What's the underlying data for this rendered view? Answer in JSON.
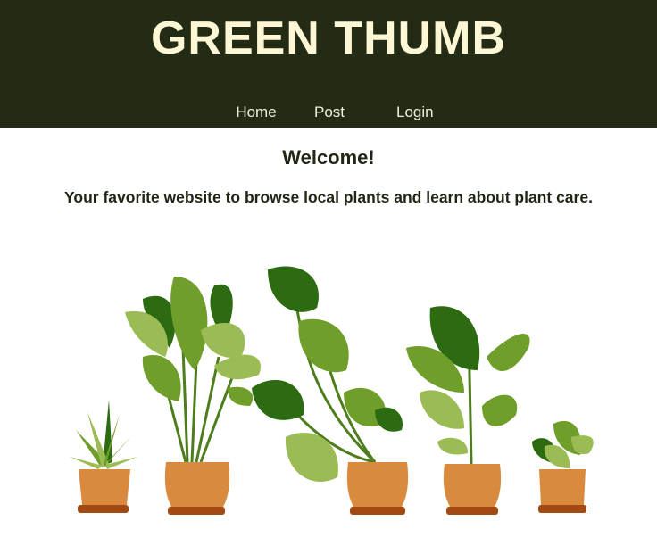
{
  "header": {
    "title": "GREEN THUMB",
    "nav": [
      {
        "label": "Home"
      },
      {
        "label": "Post"
      },
      {
        "label": "Login"
      }
    ]
  },
  "main": {
    "welcome": "Welcome!",
    "tagline": "Your favorite website to browse local plants and learn about plant care.",
    "hero_image": "potted-plants-illustration"
  },
  "colors": {
    "header_bg": "#232b14",
    "title_color": "#fdf7d6",
    "pot": "#d98a3f",
    "pot_base": "#a24a12",
    "leaf_dark": "#2d6b12",
    "leaf_mid": "#6f9e2a",
    "leaf_light": "#9bbb55"
  }
}
